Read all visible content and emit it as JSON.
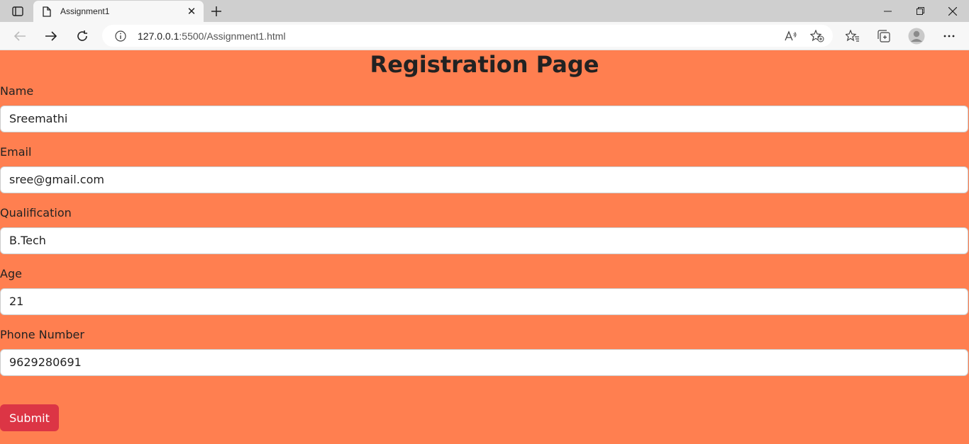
{
  "browser": {
    "tab_title": "Assignment1",
    "url_host": "127.0.0.1",
    "url_rest": ":5500/Assignment1.html"
  },
  "page": {
    "heading": "Registration Page",
    "fields": [
      {
        "label": "Name",
        "value": "Sreemathi"
      },
      {
        "label": "Email",
        "value": "sree@gmail.com"
      },
      {
        "label": "Qualification",
        "value": "B.Tech"
      },
      {
        "label": "Age",
        "value": "21"
      },
      {
        "label": "Phone Number",
        "value": "9629280691"
      }
    ],
    "submit_label": "Submit"
  },
  "colors": {
    "page_background": "#ff7f50",
    "submit_button": "#dc3545"
  }
}
